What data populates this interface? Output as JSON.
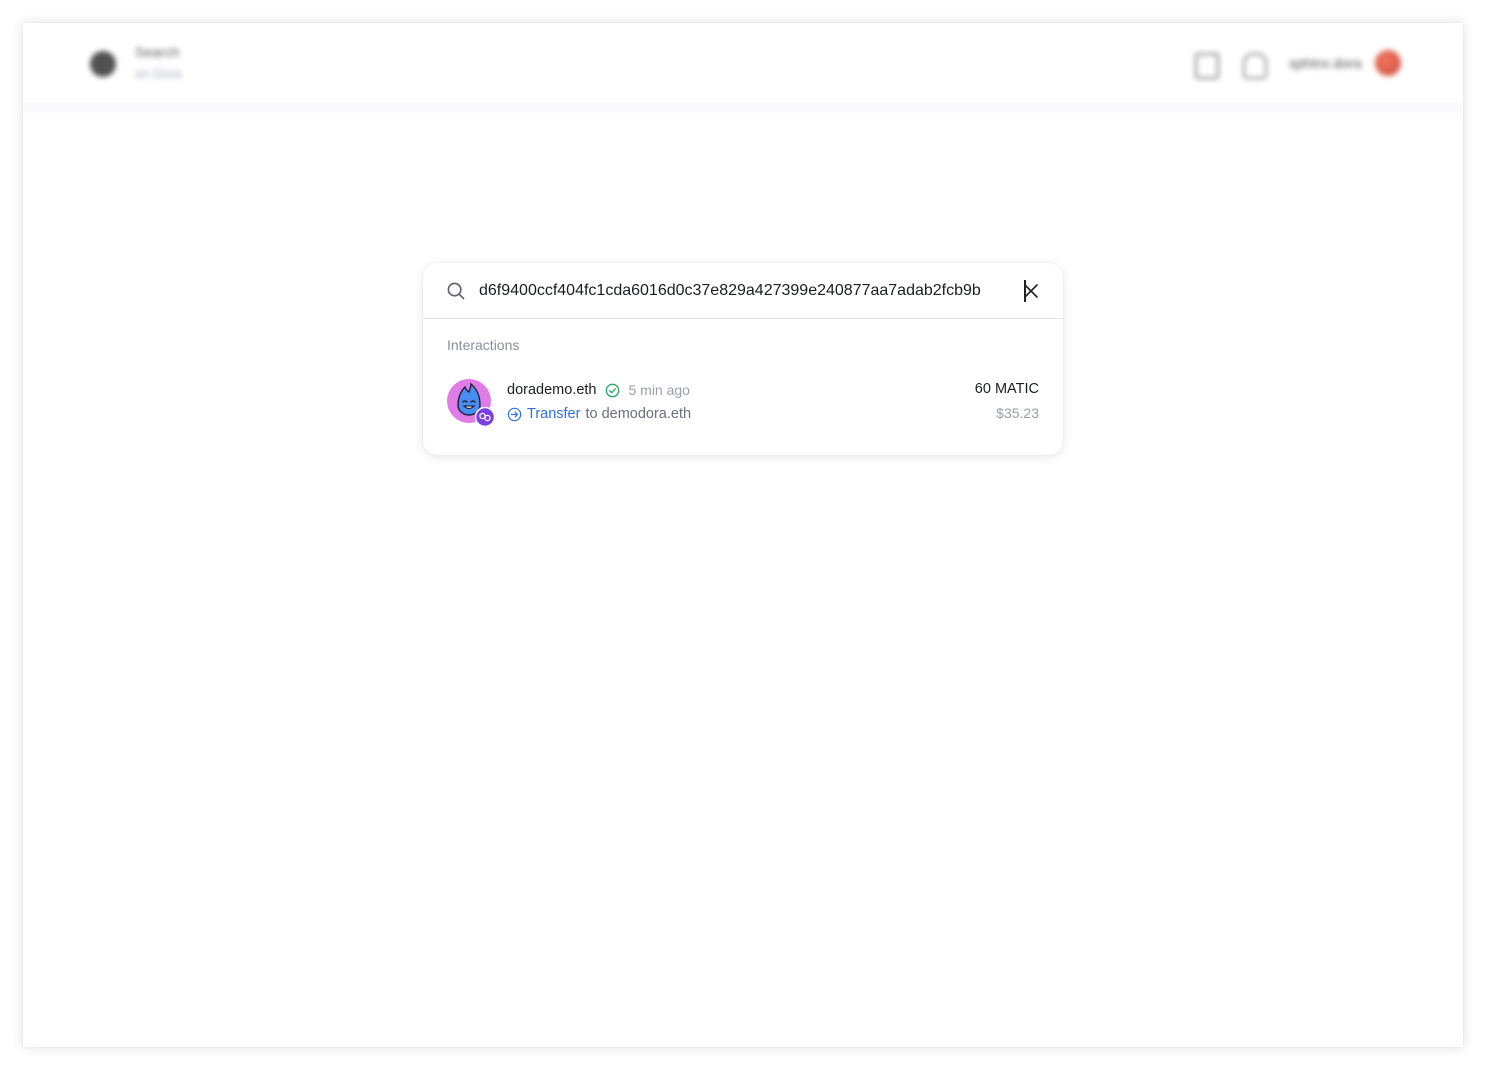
{
  "header": {
    "brand_title": "Search",
    "brand_subtitle": "on Dora",
    "user_name": "sphinx.dora",
    "icons": [
      "logo-icon",
      "document-icon",
      "bell-icon",
      "user-avatar"
    ]
  },
  "search": {
    "query": "d6f9400ccf404fc1cda6016d0c37e829a427399e240877aa7adab2fcb9b",
    "icons": [
      "search-icon",
      "close-icon"
    ]
  },
  "results": {
    "section_label": "Interactions",
    "items": [
      {
        "account": "dorademo.eth",
        "verified": true,
        "time_ago": "5 min ago",
        "action": "Transfer",
        "action_rest": "to demodora.eth",
        "amount": "60 MATIC",
        "fiat": "$35.23",
        "icons": [
          "avatar-icon",
          "chain-badge-icon",
          "verified-check-icon",
          "transfer-arrow-icon"
        ]
      }
    ]
  },
  "colors": {
    "accent": "#2f6fe0",
    "verified": "#2aa66b",
    "badge": "#7b3fe4",
    "avatar_bg": "#e07ce8",
    "avatar_face": "#4a8df0"
  }
}
